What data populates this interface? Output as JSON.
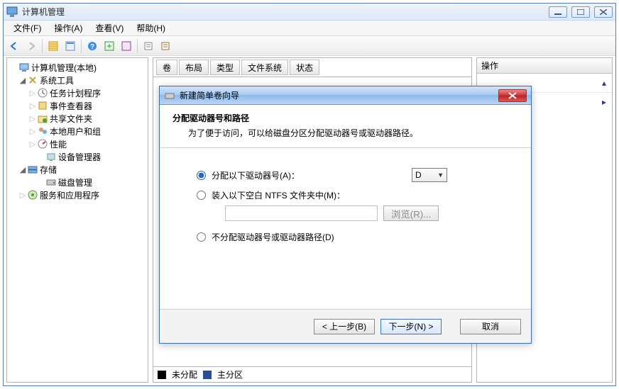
{
  "window": {
    "title": "计算机管理"
  },
  "menubar": {
    "file": "文件(F)",
    "action": "操作(A)",
    "view": "查看(V)",
    "help": "帮助(H)"
  },
  "tree": {
    "root": "计算机管理(本地)",
    "systools": "系统工具",
    "scheduler": "任务计划程序",
    "eventviewer": "事件查看器",
    "sharedfolders": "共享文件夹",
    "localusers": "本地用户和组",
    "performance": "性能",
    "devicemgr": "设备管理器",
    "storage": "存储",
    "diskmgmt": "磁盘管理",
    "services": "服务和应用程序"
  },
  "columns": {
    "volume": "卷",
    "layout": "布局",
    "type": "类型",
    "fs": "文件系统",
    "status": "状态"
  },
  "rightpanel": {
    "header": "操作"
  },
  "legend": {
    "unallocated": "未分配",
    "primary": "主分区"
  },
  "wizard": {
    "title": "新建简单卷向导",
    "heading": "分配驱动器号和路径",
    "subheading": "为了便于访问，可以给磁盘分区分配驱动器号或驱动器路径。",
    "opt_assign": "分配以下驱动器号(A)：",
    "drive_letter": "D",
    "opt_mount": "装入以下空白 NTFS 文件夹中(M)：",
    "browse": "浏览(R)...",
    "opt_none": "不分配驱动器号或驱动器路径(D)",
    "btn_back": "< 上一步(B)",
    "btn_next": "下一步(N) >",
    "btn_cancel": "取消"
  }
}
